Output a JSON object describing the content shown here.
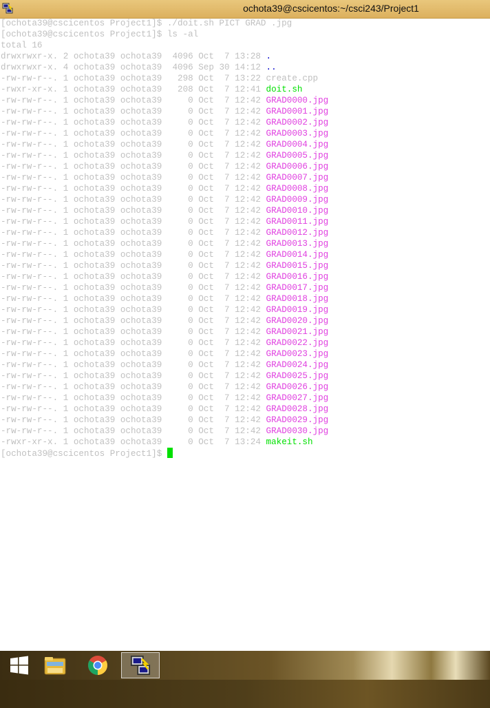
{
  "window": {
    "title": "ochota39@cscicentos:~/csci243/Project1"
  },
  "terminal": {
    "prompt": "[ochota39@cscicentos Project1]$",
    "commands": [
      "./doit.sh PICT GRAD .jpg",
      "ls -al"
    ],
    "total": "total 16",
    "entries": [
      {
        "perms": "drwxrwxr-x.",
        "links": "2",
        "owner": "ochota39",
        "group": "ochota39",
        "size": "4096",
        "month": "Oct",
        "day": "7",
        "time": "13:28",
        "name": ".",
        "kind": "dir"
      },
      {
        "perms": "drwxrwxr-x.",
        "links": "4",
        "owner": "ochota39",
        "group": "ochota39",
        "size": "4096",
        "month": "Sep",
        "day": "30",
        "time": "14:12",
        "name": "..",
        "kind": "dir"
      },
      {
        "perms": "-rw-rw-r--.",
        "links": "1",
        "owner": "ochota39",
        "group": "ochota39",
        "size": "298",
        "month": "Oct",
        "day": "7",
        "time": "13:22",
        "name": "create.cpp",
        "kind": "plain"
      },
      {
        "perms": "-rwxr-xr-x.",
        "links": "1",
        "owner": "ochota39",
        "group": "ochota39",
        "size": "208",
        "month": "Oct",
        "day": "7",
        "time": "12:41",
        "name": "doit.sh",
        "kind": "exec"
      },
      {
        "perms": "-rw-rw-r--.",
        "links": "1",
        "owner": "ochota39",
        "group": "ochota39",
        "size": "0",
        "month": "Oct",
        "day": "7",
        "time": "12:42",
        "name": "GRAD0000.jpg",
        "kind": "jpg"
      },
      {
        "perms": "-rw-rw-r--.",
        "links": "1",
        "owner": "ochota39",
        "group": "ochota39",
        "size": "0",
        "month": "Oct",
        "day": "7",
        "time": "12:42",
        "name": "GRAD0001.jpg",
        "kind": "jpg"
      },
      {
        "perms": "-rw-rw-r--.",
        "links": "1",
        "owner": "ochota39",
        "group": "ochota39",
        "size": "0",
        "month": "Oct",
        "day": "7",
        "time": "12:42",
        "name": "GRAD0002.jpg",
        "kind": "jpg"
      },
      {
        "perms": "-rw-rw-r--.",
        "links": "1",
        "owner": "ochota39",
        "group": "ochota39",
        "size": "0",
        "month": "Oct",
        "day": "7",
        "time": "12:42",
        "name": "GRAD0003.jpg",
        "kind": "jpg"
      },
      {
        "perms": "-rw-rw-r--.",
        "links": "1",
        "owner": "ochota39",
        "group": "ochota39",
        "size": "0",
        "month": "Oct",
        "day": "7",
        "time": "12:42",
        "name": "GRAD0004.jpg",
        "kind": "jpg"
      },
      {
        "perms": "-rw-rw-r--.",
        "links": "1",
        "owner": "ochota39",
        "group": "ochota39",
        "size": "0",
        "month": "Oct",
        "day": "7",
        "time": "12:42",
        "name": "GRAD0005.jpg",
        "kind": "jpg"
      },
      {
        "perms": "-rw-rw-r--.",
        "links": "1",
        "owner": "ochota39",
        "group": "ochota39",
        "size": "0",
        "month": "Oct",
        "day": "7",
        "time": "12:42",
        "name": "GRAD0006.jpg",
        "kind": "jpg"
      },
      {
        "perms": "-rw-rw-r--.",
        "links": "1",
        "owner": "ochota39",
        "group": "ochota39",
        "size": "0",
        "month": "Oct",
        "day": "7",
        "time": "12:42",
        "name": "GRAD0007.jpg",
        "kind": "jpg"
      },
      {
        "perms": "-rw-rw-r--.",
        "links": "1",
        "owner": "ochota39",
        "group": "ochota39",
        "size": "0",
        "month": "Oct",
        "day": "7",
        "time": "12:42",
        "name": "GRAD0008.jpg",
        "kind": "jpg"
      },
      {
        "perms": "-rw-rw-r--.",
        "links": "1",
        "owner": "ochota39",
        "group": "ochota39",
        "size": "0",
        "month": "Oct",
        "day": "7",
        "time": "12:42",
        "name": "GRAD0009.jpg",
        "kind": "jpg"
      },
      {
        "perms": "-rw-rw-r--.",
        "links": "1",
        "owner": "ochota39",
        "group": "ochota39",
        "size": "0",
        "month": "Oct",
        "day": "7",
        "time": "12:42",
        "name": "GRAD0010.jpg",
        "kind": "jpg"
      },
      {
        "perms": "-rw-rw-r--.",
        "links": "1",
        "owner": "ochota39",
        "group": "ochota39",
        "size": "0",
        "month": "Oct",
        "day": "7",
        "time": "12:42",
        "name": "GRAD0011.jpg",
        "kind": "jpg"
      },
      {
        "perms": "-rw-rw-r--.",
        "links": "1",
        "owner": "ochota39",
        "group": "ochota39",
        "size": "0",
        "month": "Oct",
        "day": "7",
        "time": "12:42",
        "name": "GRAD0012.jpg",
        "kind": "jpg"
      },
      {
        "perms": "-rw-rw-r--.",
        "links": "1",
        "owner": "ochota39",
        "group": "ochota39",
        "size": "0",
        "month": "Oct",
        "day": "7",
        "time": "12:42",
        "name": "GRAD0013.jpg",
        "kind": "jpg"
      },
      {
        "perms": "-rw-rw-r--.",
        "links": "1",
        "owner": "ochota39",
        "group": "ochota39",
        "size": "0",
        "month": "Oct",
        "day": "7",
        "time": "12:42",
        "name": "GRAD0014.jpg",
        "kind": "jpg"
      },
      {
        "perms": "-rw-rw-r--.",
        "links": "1",
        "owner": "ochota39",
        "group": "ochota39",
        "size": "0",
        "month": "Oct",
        "day": "7",
        "time": "12:42",
        "name": "GRAD0015.jpg",
        "kind": "jpg"
      },
      {
        "perms": "-rw-rw-r--.",
        "links": "1",
        "owner": "ochota39",
        "group": "ochota39",
        "size": "0",
        "month": "Oct",
        "day": "7",
        "time": "12:42",
        "name": "GRAD0016.jpg",
        "kind": "jpg"
      },
      {
        "perms": "-rw-rw-r--.",
        "links": "1",
        "owner": "ochota39",
        "group": "ochota39",
        "size": "0",
        "month": "Oct",
        "day": "7",
        "time": "12:42",
        "name": "GRAD0017.jpg",
        "kind": "jpg"
      },
      {
        "perms": "-rw-rw-r--.",
        "links": "1",
        "owner": "ochota39",
        "group": "ochota39",
        "size": "0",
        "month": "Oct",
        "day": "7",
        "time": "12:42",
        "name": "GRAD0018.jpg",
        "kind": "jpg"
      },
      {
        "perms": "-rw-rw-r--.",
        "links": "1",
        "owner": "ochota39",
        "group": "ochota39",
        "size": "0",
        "month": "Oct",
        "day": "7",
        "time": "12:42",
        "name": "GRAD0019.jpg",
        "kind": "jpg"
      },
      {
        "perms": "-rw-rw-r--.",
        "links": "1",
        "owner": "ochota39",
        "group": "ochota39",
        "size": "0",
        "month": "Oct",
        "day": "7",
        "time": "12:42",
        "name": "GRAD0020.jpg",
        "kind": "jpg"
      },
      {
        "perms": "-rw-rw-r--.",
        "links": "1",
        "owner": "ochota39",
        "group": "ochota39",
        "size": "0",
        "month": "Oct",
        "day": "7",
        "time": "12:42",
        "name": "GRAD0021.jpg",
        "kind": "jpg"
      },
      {
        "perms": "-rw-rw-r--.",
        "links": "1",
        "owner": "ochota39",
        "group": "ochota39",
        "size": "0",
        "month": "Oct",
        "day": "7",
        "time": "12:42",
        "name": "GRAD0022.jpg",
        "kind": "jpg"
      },
      {
        "perms": "-rw-rw-r--.",
        "links": "1",
        "owner": "ochota39",
        "group": "ochota39",
        "size": "0",
        "month": "Oct",
        "day": "7",
        "time": "12:42",
        "name": "GRAD0023.jpg",
        "kind": "jpg"
      },
      {
        "perms": "-rw-rw-r--.",
        "links": "1",
        "owner": "ochota39",
        "group": "ochota39",
        "size": "0",
        "month": "Oct",
        "day": "7",
        "time": "12:42",
        "name": "GRAD0024.jpg",
        "kind": "jpg"
      },
      {
        "perms": "-rw-rw-r--.",
        "links": "1",
        "owner": "ochota39",
        "group": "ochota39",
        "size": "0",
        "month": "Oct",
        "day": "7",
        "time": "12:42",
        "name": "GRAD0025.jpg",
        "kind": "jpg"
      },
      {
        "perms": "-rw-rw-r--.",
        "links": "1",
        "owner": "ochota39",
        "group": "ochota39",
        "size": "0",
        "month": "Oct",
        "day": "7",
        "time": "12:42",
        "name": "GRAD0026.jpg",
        "kind": "jpg"
      },
      {
        "perms": "-rw-rw-r--.",
        "links": "1",
        "owner": "ochota39",
        "group": "ochota39",
        "size": "0",
        "month": "Oct",
        "day": "7",
        "time": "12:42",
        "name": "GRAD0027.jpg",
        "kind": "jpg"
      },
      {
        "perms": "-rw-rw-r--.",
        "links": "1",
        "owner": "ochota39",
        "group": "ochota39",
        "size": "0",
        "month": "Oct",
        "day": "7",
        "time": "12:42",
        "name": "GRAD0028.jpg",
        "kind": "jpg"
      },
      {
        "perms": "-rw-rw-r--.",
        "links": "1",
        "owner": "ochota39",
        "group": "ochota39",
        "size": "0",
        "month": "Oct",
        "day": "7",
        "time": "12:42",
        "name": "GRAD0029.jpg",
        "kind": "jpg"
      },
      {
        "perms": "-rw-rw-r--.",
        "links": "1",
        "owner": "ochota39",
        "group": "ochota39",
        "size": "0",
        "month": "Oct",
        "day": "7",
        "time": "12:42",
        "name": "GRAD0030.jpg",
        "kind": "jpg"
      },
      {
        "perms": "-rwxr-xr-x.",
        "links": "1",
        "owner": "ochota39",
        "group": "ochota39",
        "size": "0",
        "month": "Oct",
        "day": "7",
        "time": "13:24",
        "name": "makeit.sh",
        "kind": "exec"
      }
    ]
  },
  "colors": {
    "text": "#c0c0c0",
    "dir": "#0000cc",
    "exec": "#00e000",
    "jpg": "#e040e0",
    "cursor": "#00e000",
    "titlebar": "#dcb05e"
  },
  "taskbar": {
    "items": [
      {
        "icon": "windows-start-icon"
      },
      {
        "icon": "file-explorer-icon"
      },
      {
        "icon": "chrome-icon"
      },
      {
        "icon": "putty-icon",
        "active": true
      }
    ]
  }
}
